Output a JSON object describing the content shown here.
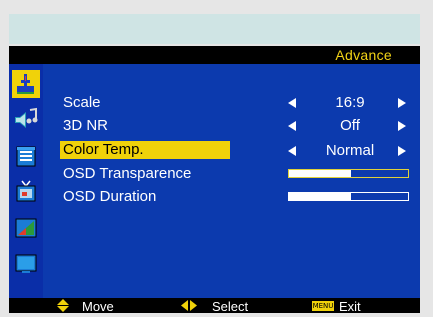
{
  "title": "Advance",
  "sidebar": {
    "icons": [
      {
        "name": "picture-icon",
        "selected": true
      },
      {
        "name": "audio-icon",
        "selected": false
      },
      {
        "name": "osd-icon",
        "selected": false
      },
      {
        "name": "tv-icon",
        "selected": false
      },
      {
        "name": "color-icon",
        "selected": false
      },
      {
        "name": "display-icon",
        "selected": false
      }
    ]
  },
  "menu": {
    "scale": {
      "label": "Scale",
      "value": "16:9"
    },
    "nr3d": {
      "label": "3D NR",
      "value": "Off"
    },
    "color_temp": {
      "label": "Color Temp.",
      "value": "Normal"
    },
    "osd_transparence": {
      "label": "OSD Transparence",
      "level": 0.52
    },
    "osd_duration": {
      "label": "OSD Duration",
      "level": 0.52
    }
  },
  "footer": {
    "move": "Move",
    "select": "Select",
    "menu_key": "MENU",
    "exit": "Exit"
  },
  "colors": {
    "panel": "#0c3aae",
    "highlight": "#f0d20a",
    "title_text": "#f2d316"
  }
}
